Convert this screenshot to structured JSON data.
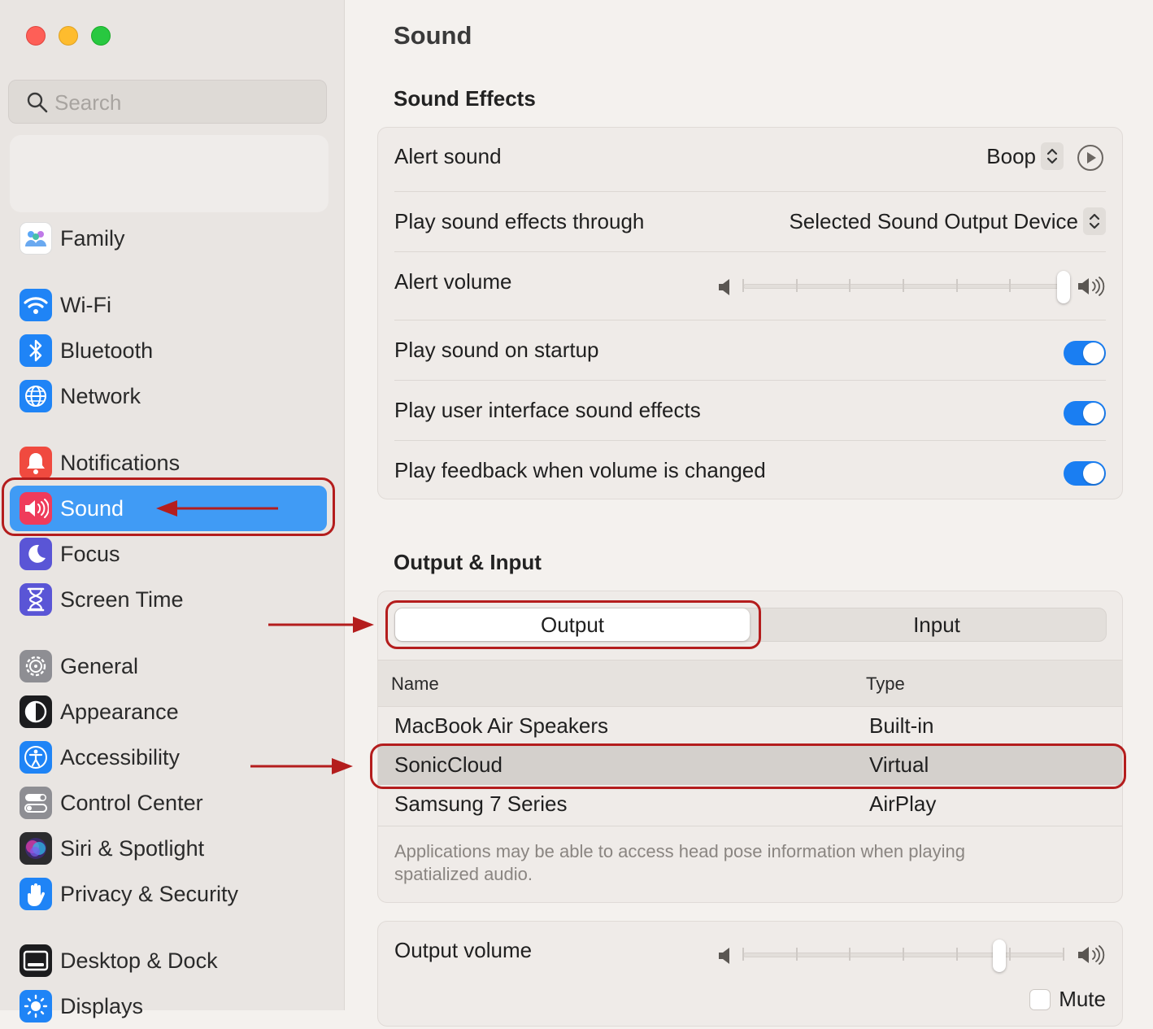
{
  "window": {
    "title": "Sound",
    "traffic_lights": [
      "close",
      "minimize",
      "zoom"
    ]
  },
  "sidebar": {
    "search_placeholder": "Search",
    "items": [
      {
        "label": "Family",
        "icon": "family-icon",
        "color": "#ffffff"
      },
      {
        "label": "Wi-Fi",
        "icon": "wifi-icon",
        "color": "#1f84f6"
      },
      {
        "label": "Bluetooth",
        "icon": "bluetooth-icon",
        "color": "#1f84f6"
      },
      {
        "label": "Network",
        "icon": "globe-icon",
        "color": "#1f84f6"
      },
      {
        "label": "Notifications",
        "icon": "bell-icon",
        "color": "#f04a3f"
      },
      {
        "label": "Sound",
        "icon": "speaker-icon",
        "color": "#ef3b5b",
        "active": true
      },
      {
        "label": "Focus",
        "icon": "moon-icon",
        "color": "#5a55d6"
      },
      {
        "label": "Screen Time",
        "icon": "hourglass-icon",
        "color": "#5a55d6"
      },
      {
        "label": "General",
        "icon": "gear-icon",
        "color": "#8e8e93"
      },
      {
        "label": "Appearance",
        "icon": "appearance-icon",
        "color": "#1c1c1e"
      },
      {
        "label": "Accessibility",
        "icon": "accessibility-icon",
        "color": "#1f84f6"
      },
      {
        "label": "Control Center",
        "icon": "control-center-icon",
        "color": "#8e8e93"
      },
      {
        "label": "Siri & Spotlight",
        "icon": "siri-icon",
        "color": "#2c2c2e"
      },
      {
        "label": "Privacy & Security",
        "icon": "hand-icon",
        "color": "#1f84f6"
      },
      {
        "label": "Desktop & Dock",
        "icon": "dock-icon",
        "color": "#1c1c1e"
      },
      {
        "label": "Displays",
        "icon": "sun-icon",
        "color": "#1f84f6"
      }
    ]
  },
  "main": {
    "title": "Sound",
    "sound_effects": {
      "heading": "Sound Effects",
      "alert_sound": {
        "label": "Alert sound",
        "value": "Boop"
      },
      "play_through": {
        "label": "Play sound effects through",
        "value": "Selected Sound Output Device"
      },
      "alert_volume": {
        "label": "Alert volume",
        "level": 1.0
      },
      "startup": {
        "label": "Play sound on startup",
        "on": true
      },
      "ui_effects": {
        "label": "Play user interface sound effects",
        "on": true
      },
      "feedback": {
        "label": "Play feedback when volume is changed",
        "on": true
      }
    },
    "output_input": {
      "heading": "Output & Input",
      "tabs": [
        "Output",
        "Input"
      ],
      "selected_tab": "Output",
      "columns": [
        "Name",
        "Type"
      ],
      "devices": [
        {
          "name": "MacBook Air Speakers",
          "type": "Built-in"
        },
        {
          "name": "SonicCloud",
          "type": "Virtual",
          "selected": true
        },
        {
          "name": "Samsung 7 Series",
          "type": "AirPlay"
        }
      ],
      "note": "Applications may be able to access head pose information when playing spatialized audio."
    },
    "output_volume": {
      "label": "Output volume",
      "level": 0.8,
      "mute_label": "Mute",
      "muted": false
    }
  },
  "colors": {
    "accent": "#1a7ef2",
    "sidebar_selected": "#409bf5",
    "annotation": "#b41d1d"
  }
}
